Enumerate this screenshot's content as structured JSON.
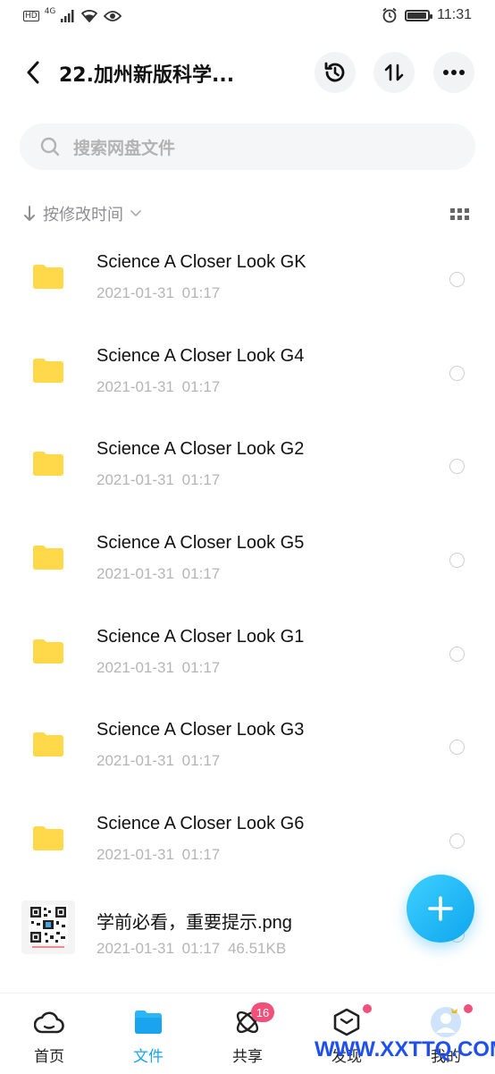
{
  "status_bar": {
    "network": "4G",
    "time": "11:31"
  },
  "header": {
    "title": "22.加州新版科学...",
    "back_icon": "back-arrow-icon",
    "history_icon": "history-icon",
    "sort_icon": "sort-arrows-icon",
    "more_icon": "more-dots-icon"
  },
  "search": {
    "placeholder": "搜索网盘文件"
  },
  "sort_bar": {
    "label": "按修改时间"
  },
  "files": [
    {
      "name": "Science A Closer Look GK",
      "meta": "2021-01-31 01:17",
      "type": "folder"
    },
    {
      "name": "Science A Closer Look G4",
      "meta": "2021-01-31 01:17",
      "type": "folder"
    },
    {
      "name": "Science A Closer Look G2",
      "meta": "2021-01-31 01:17",
      "type": "folder"
    },
    {
      "name": "Science A Closer Look G5",
      "meta": "2021-01-31 01:17",
      "type": "folder"
    },
    {
      "name": "Science A Closer Look G1",
      "meta": "2021-01-31 01:17",
      "type": "folder"
    },
    {
      "name": "Science A Closer Look G3",
      "meta": "2021-01-31 01:17",
      "type": "folder"
    },
    {
      "name": "Science A Closer Look G6",
      "meta": "2021-01-31 01:17",
      "type": "folder"
    },
    {
      "name": "学前必看，重要提示.png",
      "meta": "2021-01-31 01:17 46.51KB",
      "type": "image"
    }
  ],
  "bottom_nav": {
    "tabs": [
      {
        "label": "首页",
        "icon": "cloud-home-icon"
      },
      {
        "label": "文件",
        "icon": "folder-icon"
      },
      {
        "label": "共享",
        "icon": "share-atom-icon",
        "badge": "16"
      },
      {
        "label": "发现",
        "icon": "discover-box-icon"
      },
      {
        "label": "我的",
        "icon": "avatar-icon"
      }
    ]
  },
  "watermark": "WWW.XXTTQ.COM",
  "colors": {
    "accent": "#1aa3ee",
    "folder": "#ffd94a",
    "badge": "#f0507a"
  }
}
